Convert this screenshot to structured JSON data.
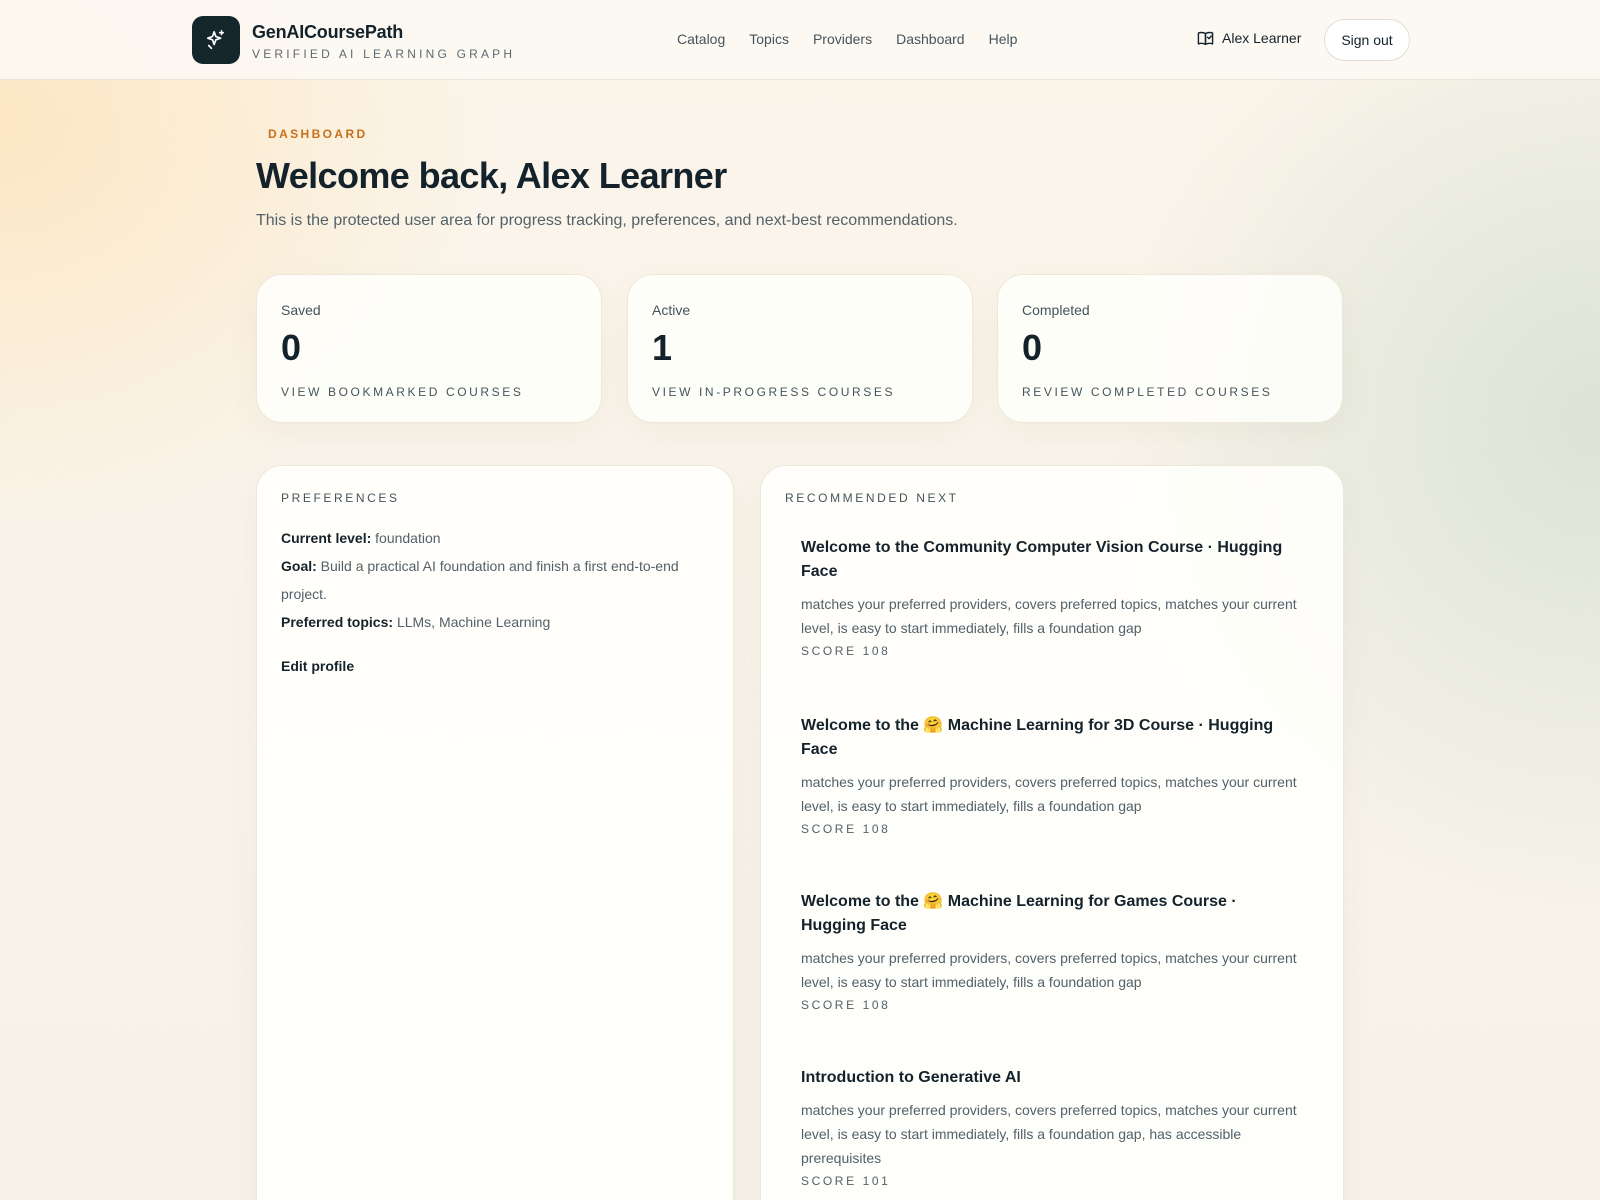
{
  "header": {
    "brand_name": "GenAICoursePath",
    "brand_tagline": "VERIFIED AI LEARNING GRAPH",
    "nav": [
      "Catalog",
      "Topics",
      "Providers",
      "Dashboard",
      "Help"
    ],
    "user_name": "Alex Learner",
    "signout_label": "Sign out"
  },
  "page": {
    "eyebrow": "DASHBOARD",
    "title": "Welcome back, Alex Learner",
    "subtitle": "This is the protected user area for progress tracking, preferences, and next-best recommendations."
  },
  "stats": [
    {
      "label": "Saved",
      "value": "0",
      "link": "VIEW BOOKMARKED COURSES"
    },
    {
      "label": "Active",
      "value": "1",
      "link": "VIEW IN-PROGRESS COURSES"
    },
    {
      "label": "Completed",
      "value": "0",
      "link": "REVIEW COMPLETED COURSES"
    }
  ],
  "preferences": {
    "title": "PREFERENCES",
    "level_label": "Current level:",
    "level_value": "foundation",
    "goal_label": "Goal:",
    "goal_value": "Build a practical AI foundation and finish a first end-to-end project.",
    "topics_label": "Preferred topics:",
    "topics_value": "LLMs, Machine Learning",
    "edit_label": "Edit profile"
  },
  "recommended": {
    "title": "RECOMMENDED NEXT",
    "items": [
      {
        "title": "Welcome to the Community Computer Vision Course · Hugging Face",
        "reason": "matches your preferred providers, covers preferred topics, matches your current level, is easy to start immediately, fills a foundation gap",
        "score": "SCORE 108"
      },
      {
        "title": "Welcome to the 🤗 Machine Learning for 3D Course · Hugging Face",
        "reason": "matches your preferred providers, covers preferred topics, matches your current level, is easy to start immediately, fills a foundation gap",
        "score": "SCORE 108"
      },
      {
        "title": "Welcome to the 🤗 Machine Learning for Games Course · Hugging Face",
        "reason": "matches your preferred providers, covers preferred topics, matches your current level, is easy to start immediately, fills a foundation gap",
        "score": "SCORE 108"
      },
      {
        "title": "Introduction to Generative AI",
        "reason": "matches your preferred providers, covers preferred topics, matches your current level, is easy to start immediately, fills a foundation gap, has accessible prerequisites",
        "score": "SCORE 101"
      }
    ]
  }
}
